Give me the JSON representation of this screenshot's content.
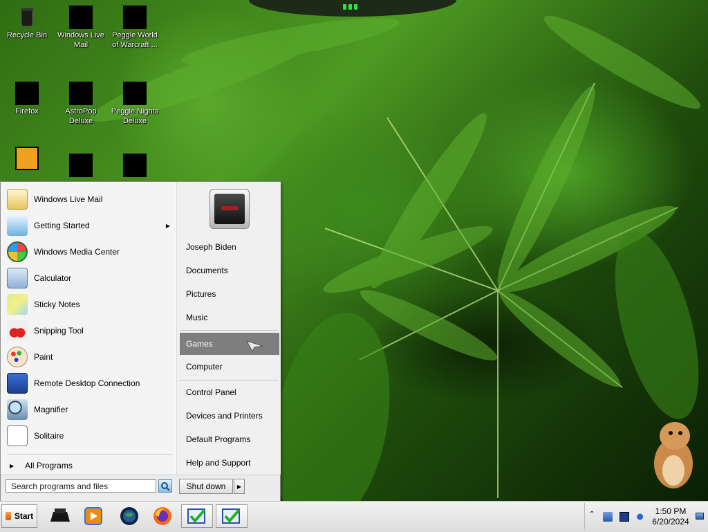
{
  "desktop": {
    "icons": [
      {
        "label": "Recycle Bin"
      },
      {
        "label": "Windows Live Mail"
      },
      {
        "label": "Peggle World of Warcraft ..."
      },
      {
        "label": "Firefox"
      },
      {
        "label": "AstroPop Deluxe"
      },
      {
        "label": "Peggle Nights Deluxe"
      }
    ]
  },
  "start_menu": {
    "programs": [
      {
        "label": "Windows Live Mail",
        "icon": "mail-icon"
      },
      {
        "label": "Getting Started",
        "icon": "getting-started-icon",
        "has_submenu": true
      },
      {
        "label": "Windows Media Center",
        "icon": "windows-logo-icon"
      },
      {
        "label": "Calculator",
        "icon": "calculator-icon"
      },
      {
        "label": "Sticky Notes",
        "icon": "sticky-notes-icon"
      },
      {
        "label": "Snipping Tool",
        "icon": "scissors-icon"
      },
      {
        "label": "Paint",
        "icon": "palette-icon"
      },
      {
        "label": "Remote Desktop Connection",
        "icon": "remote-desktop-icon"
      },
      {
        "label": "Magnifier",
        "icon": "magnifier-icon"
      },
      {
        "label": "Solitaire",
        "icon": "cards-icon"
      }
    ],
    "all_programs": "All Programs",
    "right_items": [
      {
        "label": "Joseph Biden"
      },
      {
        "label": "Documents"
      },
      {
        "label": "Pictures"
      },
      {
        "label": "Music"
      },
      {
        "label": "Games",
        "highlighted": true
      },
      {
        "label": "Computer"
      },
      {
        "label": "Control Panel"
      },
      {
        "label": "Devices and Printers"
      },
      {
        "label": "Default Programs"
      },
      {
        "label": "Help and Support"
      }
    ],
    "search": {
      "placeholder": "Search programs and files"
    },
    "shutdown": "Shut down"
  },
  "taskbar": {
    "start_label": "Start",
    "pinned": [
      {
        "icon": "printer-icon"
      },
      {
        "icon": "media-player-icon"
      },
      {
        "icon": "globe-icon"
      },
      {
        "icon": "firefox-icon"
      },
      {
        "icon": "checkmark-window-icon"
      },
      {
        "icon": "checkmark-window-icon"
      }
    ],
    "clock": {
      "time": "1:50 PM",
      "date": "6/20/2024"
    }
  },
  "colors": {
    "highlight": "#7e7e7e",
    "wallpaper_green": "#4d9a22"
  }
}
